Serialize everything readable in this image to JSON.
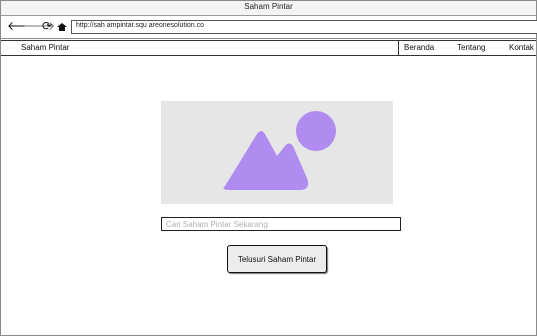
{
  "window": {
    "title": "Saham Pintar"
  },
  "browser": {
    "url": "http://sah ampintar.squ areonesolution.co",
    "icons": {
      "back": "arrow-left-icon",
      "forward": "arrow-right-icon",
      "reload": "reload-icon",
      "home": "home-icon"
    }
  },
  "navbar": {
    "brand": "Saham Pintar",
    "links": [
      {
        "label": "Beranda"
      },
      {
        "label": "Tentang"
      },
      {
        "label": "Kontak"
      }
    ]
  },
  "hero": {
    "icon": "image-placeholder-icon",
    "colors": {
      "background": "#e6e6e6",
      "shape": "#b18cf0"
    }
  },
  "search": {
    "placeholder": "Cari Saham Pintar Sekarang",
    "value": ""
  },
  "cta": {
    "label": "Telusuri Saham Pintar"
  }
}
